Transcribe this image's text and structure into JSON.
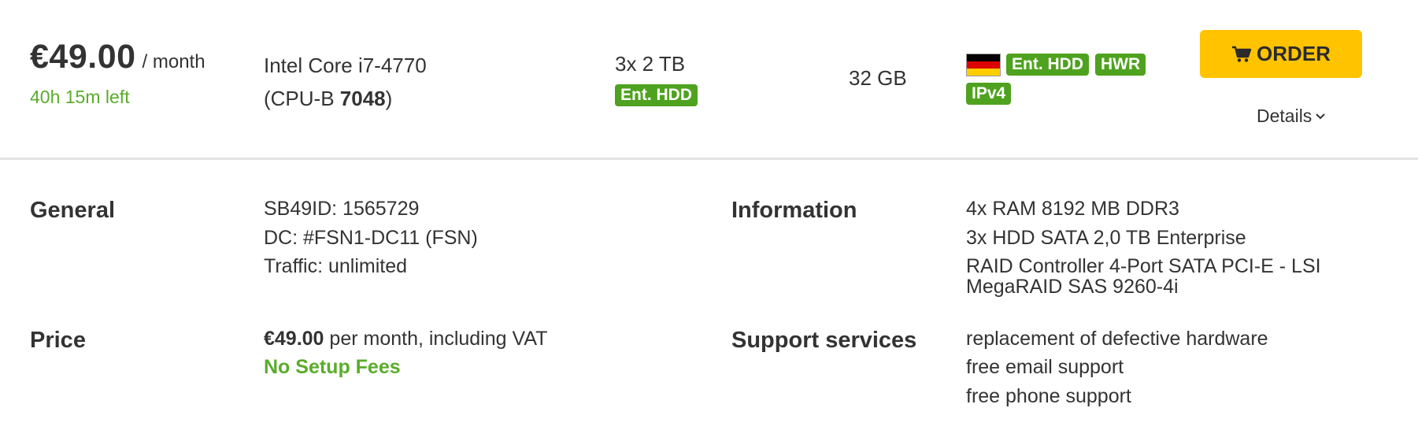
{
  "summary": {
    "price_amount": "€49.00",
    "price_period": "/ month",
    "time_left": "40h 15m left",
    "cpu_model": "Intel Core i7-4770",
    "cpu_bench_prefix": "(CPU-B ",
    "cpu_bench_value": "7048",
    "cpu_bench_suffix": ")",
    "disk": "3x 2 TB",
    "disk_badge": "Ent. HDD",
    "ram": "32 GB",
    "location_flag": "flag-germany",
    "feature_badges": [
      "Ent. HDD",
      "HWR",
      "IPv4"
    ],
    "order_label": "ORDER",
    "order_icon": "shopping-cart-icon",
    "details_label": "Details",
    "badge_color": "#4fa21f",
    "order_color": "#ffc300"
  },
  "details": {
    "general_label": "General",
    "general_lines": [
      "SB49ID: 1565729",
      "DC: #FSN1-DC11 (FSN)",
      "Traffic: unlimited"
    ],
    "information_label": "Information",
    "information_lines": [
      "4x RAM 8192 MB DDR3",
      "3x HDD SATA 2,0 TB Enterprise",
      "RAID Controller 4-Port SATA PCI-E - LSI MegaRAID SAS 9260-4i"
    ],
    "price_label": "Price",
    "price_value": "€49.00",
    "price_text": " per month, including VAT",
    "setup_fees": "No Setup Fees",
    "support_label": "Support services",
    "support_lines": [
      "replacement of defective hardware",
      "free email support",
      "free phone support"
    ]
  }
}
